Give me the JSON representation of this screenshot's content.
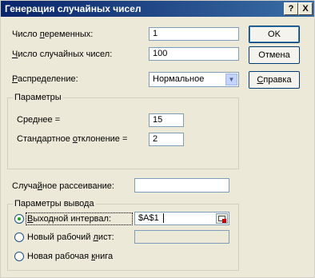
{
  "window": {
    "title": "Генерация случайных чисел",
    "help_button": "?",
    "close_button": "X"
  },
  "fields": {
    "num_variables": {
      "label_pre": "Число ",
      "label_u": "п",
      "label_post": "еременных:",
      "value": "1"
    },
    "num_random": {
      "label_pre": "",
      "label_u": "Ч",
      "label_post": "исло случайных чисел:",
      "value": "100"
    },
    "distribution": {
      "label_pre": "",
      "label_u": "Р",
      "label_post": "аспределение:",
      "value": "Нормальное"
    }
  },
  "parameters": {
    "legend": "Параметры",
    "mean": {
      "label_pre": "Сре",
      "label_u": "д",
      "label_post": "нее =",
      "value": "15"
    },
    "stddev": {
      "label_pre": "Стандартное ",
      "label_u": "о",
      "label_post": "тклонение =",
      "value": "2"
    }
  },
  "seed": {
    "label_pre": "Случа",
    "label_u": "й",
    "label_post": "ное рассеивание:",
    "value": ""
  },
  "output": {
    "legend": "Параметры вывода",
    "range": {
      "label_pre": "",
      "label_u": "В",
      "label_post": "ыходной интервал:",
      "value": "$A$1",
      "checked": true
    },
    "new_sheet": {
      "label_pre": "Новый рабочий ",
      "label_u": "л",
      "label_post": "ист:",
      "checked": false
    },
    "new_book": {
      "label_pre": "Новая рабочая ",
      "label_u": "к",
      "label_post": "нига",
      "checked": false
    }
  },
  "buttons": {
    "ok": "OK",
    "cancel": "Отмена",
    "help_pre": "",
    "help_u": "С",
    "help_post": "правка"
  }
}
